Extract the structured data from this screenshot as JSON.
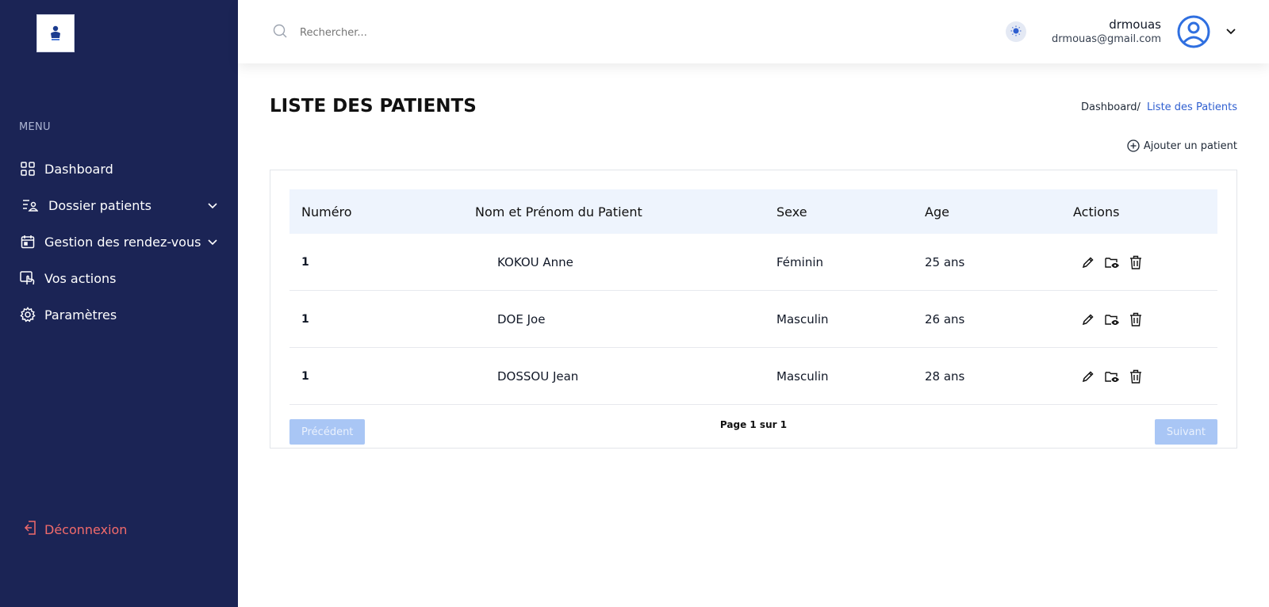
{
  "sidebar": {
    "menu_title": "MENU",
    "items": [
      {
        "label": "Dashboard"
      },
      {
        "label": "Dossier patients"
      },
      {
        "label": "Gestion des rendez-vous"
      },
      {
        "label": "Vos actions"
      },
      {
        "label": "Paramètres"
      }
    ],
    "logout_label": "Déconnexion"
  },
  "header": {
    "search_placeholder": "Rechercher...",
    "user_name": "drmouas",
    "user_email": "drmouas@gmail.com"
  },
  "main": {
    "title": "LISTE DES PATIENTS",
    "breadcrumb": {
      "home": "Dashboard/",
      "current": "Liste des Patients"
    },
    "add_label": "Ajouter un patient",
    "table": {
      "headers": [
        "Numéro",
        "Nom et Prénom du Patient",
        "Sexe",
        "Age",
        "Actions"
      ],
      "rows": [
        {
          "numero": "1",
          "nom": "KOKOU Anne",
          "sexe": "Féminin",
          "age": "25 ans"
        },
        {
          "numero": "1",
          "nom": "DOE Joe",
          "sexe": "Masculin",
          "age": "26 ans"
        },
        {
          "numero": "1",
          "nom": "DOSSOU Jean",
          "sexe": "Masculin",
          "age": "28 ans"
        }
      ]
    },
    "pagination": {
      "prev": "Précédent",
      "info": "Page 1 sur 1",
      "next": "Suivant"
    }
  },
  "colors": {
    "sidebar": "#1b2455",
    "accent": "#2f5fd0",
    "danger": "#f26b6b",
    "table_head": "#eef4fd",
    "pager_btn": "#a9c6f5"
  },
  "icons": [
    "grid-icon",
    "folder-users-icon",
    "calendar-icon",
    "hand-pointer-icon",
    "gear-icon",
    "logout-icon",
    "search-icon",
    "sun-icon",
    "user-circle-icon",
    "plus-circle-icon",
    "pencil-icon",
    "folder-eye-icon",
    "trash-icon"
  ]
}
